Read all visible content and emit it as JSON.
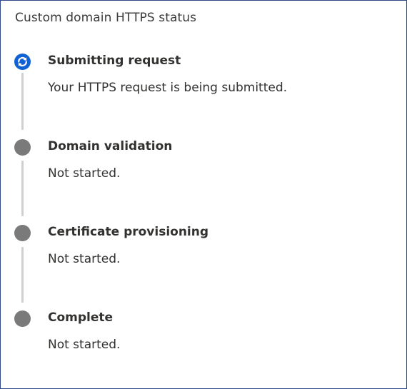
{
  "panel": {
    "title": "Custom domain HTTPS status"
  },
  "steps": [
    {
      "title": "Submitting request",
      "description": "Your HTTPS request is being submitted.",
      "state": "in-progress",
      "icon": "sync-icon",
      "color": "#0f62d6"
    },
    {
      "title": "Domain validation",
      "description": "Not started.",
      "state": "not-started",
      "icon": "circle-icon",
      "color": "#7a7a7a"
    },
    {
      "title": "Certificate provisioning",
      "description": "Not started.",
      "state": "not-started",
      "icon": "circle-icon",
      "color": "#7a7a7a"
    },
    {
      "title": "Complete",
      "description": "Not started.",
      "state": "not-started",
      "icon": "circle-icon",
      "color": "#7a7a7a"
    }
  ],
  "colors": {
    "border": "#2f4a8a",
    "rail": "#d2d0ce",
    "text": "#323130"
  }
}
